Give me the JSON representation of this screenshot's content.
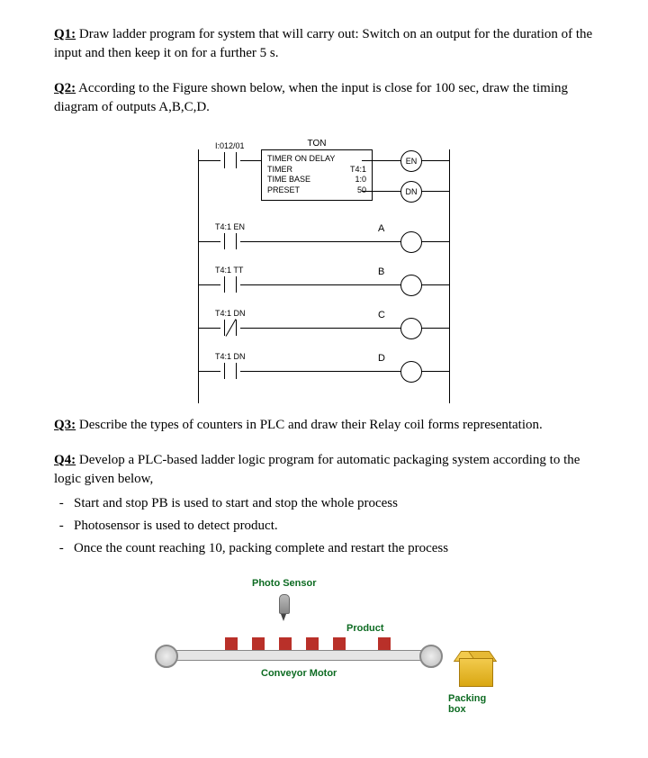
{
  "q1": {
    "label": "Q1:",
    "text_a": " Draw ladder program for system that will carry out: Switch on an output for the duration of the input and then keep it on for a further 5 s."
  },
  "q2": {
    "label": "Q2:",
    "text_a": " According to the Figure shown below, when the input is close for 100 sec, draw the timing diagram of outputs A,B,C,D."
  },
  "ladder": {
    "input_addr": "I:012/01",
    "timer_title": "TON",
    "timer_line1": "TIMER ON DELAY",
    "timer_line2_l": "TIMER",
    "timer_line2_r": "T4:1",
    "timer_line3_l": "TIME BASE",
    "timer_line3_r": "1:0",
    "timer_line4_l": "PRESET",
    "timer_line4_r": "50",
    "coil_en": "EN",
    "coil_dn": "DN",
    "rung2_contact": "T4:1 EN",
    "rung2_out": "A",
    "rung3_contact": "T4:1 TT",
    "rung3_out": "B",
    "rung4_contact": "T4:1 DN",
    "rung4_out": "C",
    "rung5_contact": "T4:1 DN",
    "rung5_out": "D"
  },
  "q3": {
    "label": "Q3:",
    "text": " Describe the types of counters in PLC and draw their Relay coil forms representation."
  },
  "q4": {
    "label": "Q4:",
    "text": " Develop a PLC-based ladder logic program for automatic packaging system according to the logic given below,",
    "b1": "Start and stop PB is used to start and stop the whole process",
    "b2": "Photosensor is used to detect product.",
    "b3": "Once the count reaching 10, packing complete and restart the process"
  },
  "conveyor": {
    "sensor": "Photo Sensor",
    "product": "Product",
    "motor": "Conveyor Motor",
    "box": "Packing box"
  }
}
